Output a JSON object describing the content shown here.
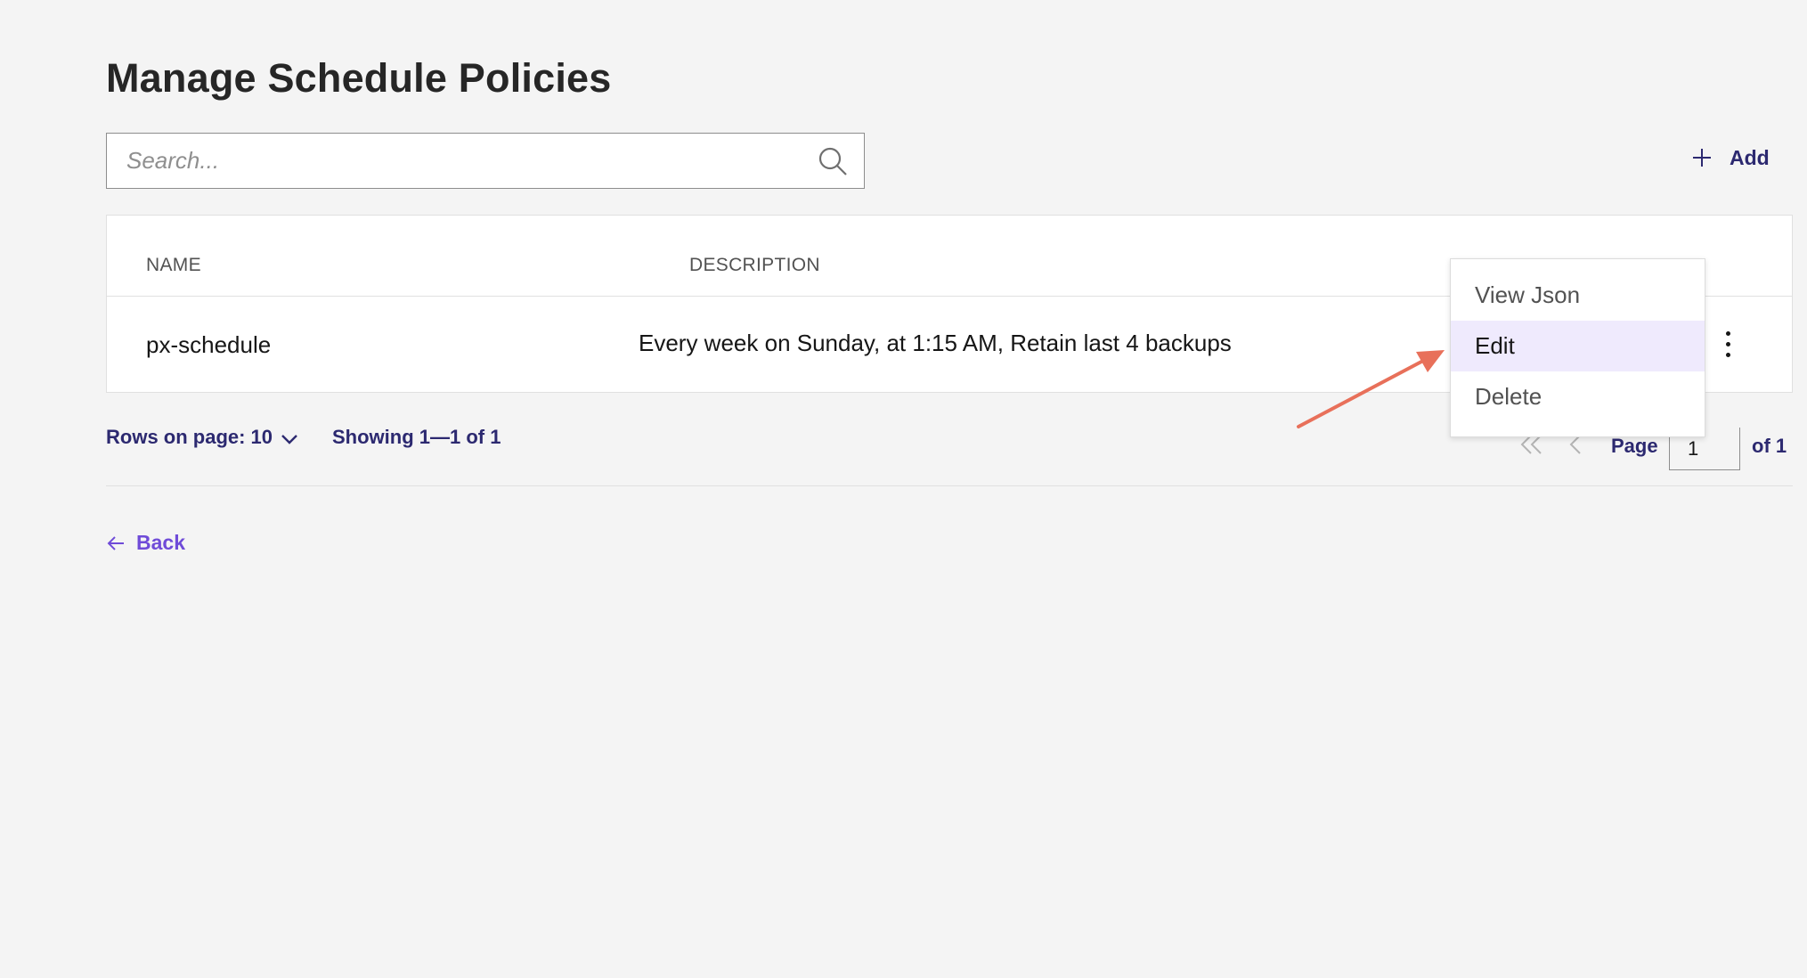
{
  "page": {
    "title": "Manage Schedule Policies"
  },
  "search": {
    "placeholder": "Search..."
  },
  "toolbar": {
    "add_label": "Add"
  },
  "table": {
    "columns": [
      "NAME",
      "DESCRIPTION"
    ],
    "rows": [
      {
        "name": "px-schedule",
        "description": "Every week on Sunday, at 1:15 AM, Retain last 4 backups"
      }
    ]
  },
  "context_menu": {
    "items": [
      "View Json",
      "Edit",
      "Delete"
    ],
    "highlighted": "Edit"
  },
  "pagination": {
    "rows_label": "Rows on page: 10",
    "showing": "Showing 1—1 of 1",
    "page_label": "Page",
    "page_value": "1",
    "of_label": "of 1"
  },
  "nav": {
    "back_label": "Back"
  },
  "colors": {
    "accent": "#2c2970",
    "link": "#6f4bd8",
    "highlight": "#efeafd",
    "annotation_arrow": "#e8705a"
  },
  "icons": [
    "search-icon",
    "plus-icon",
    "more-vertical-icon",
    "chevron-down-icon",
    "first-page-icon",
    "previous-page-icon",
    "next-page-icon",
    "last-page-icon",
    "arrow-left-icon"
  ]
}
